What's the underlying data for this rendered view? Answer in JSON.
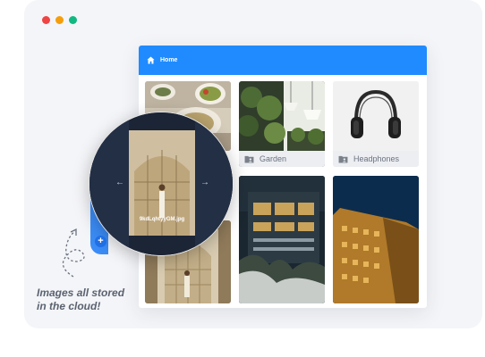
{
  "window_dots": [
    "#ef4444",
    "#f59e0b",
    "#10b981"
  ],
  "colors": {
    "accent": "#1f8bff",
    "caption_bar": "#eceef2"
  },
  "header": {
    "home_label": "Home",
    "icon": "home-icon"
  },
  "tiles": [
    {
      "name": "food",
      "caption": ""
    },
    {
      "name": "Garden",
      "caption": "Garden",
      "icon": "folder-user-icon"
    },
    {
      "name": "Headphones",
      "caption": "Headphones",
      "icon": "folder-user-icon"
    },
    {
      "name": "arch-building",
      "caption": ""
    },
    {
      "name": "glass-building",
      "caption": ""
    },
    {
      "name": "golden-building",
      "caption": ""
    }
  ],
  "lightbox": {
    "filename": "9kdLqhtyyGM.jpg",
    "prev_icon": "arrow-left-icon",
    "next_icon": "arrow-right-icon"
  },
  "upload": {
    "plus": "+"
  },
  "tagline": {
    "line1": "Images all stored",
    "line2": "in the cloud!"
  }
}
